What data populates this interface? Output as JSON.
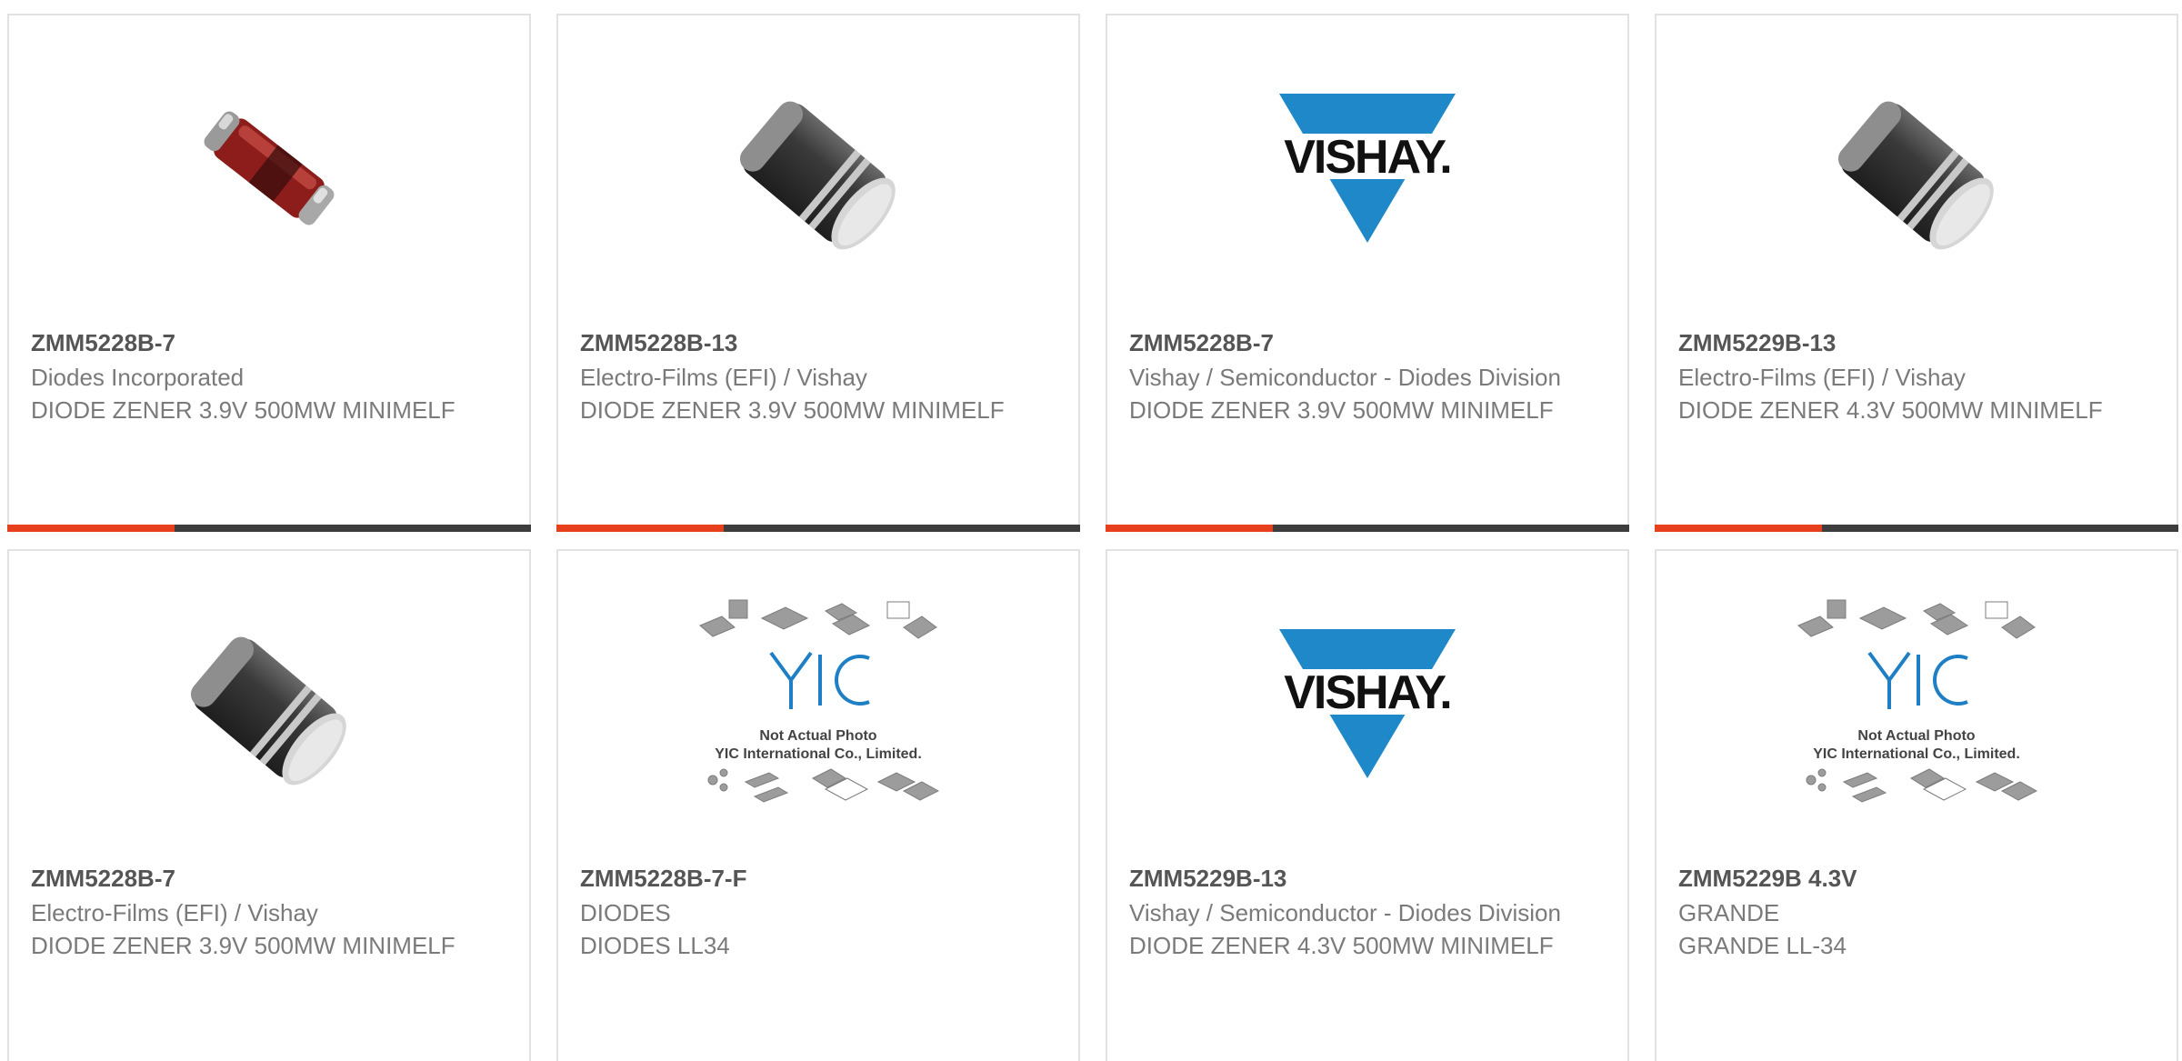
{
  "colors": {
    "accent": "#e8401c",
    "bar_dark": "#3d3d3d",
    "vishay_blue": "#1f88c9",
    "card_border": "#e2e2e2"
  },
  "products": [
    {
      "part_number": "ZMM5228B-7",
      "manufacturer": "Diodes Incorporated",
      "description": "DIODE ZENER 3.9V 500MW MINIMELF",
      "image": "red-melf-diode-photo"
    },
    {
      "part_number": "ZMM5228B-13",
      "manufacturer": "Electro-Films (EFI) / Vishay",
      "description": "DIODE ZENER 3.9V 500MW MINIMELF",
      "image": "black-melf-diode-photo"
    },
    {
      "part_number": "ZMM5228B-7",
      "manufacturer": "Vishay / Semiconductor - Diodes Division",
      "description": "DIODE ZENER 3.9V 500MW MINIMELF",
      "image": "vishay-logo",
      "logo_text": "VISHAY."
    },
    {
      "part_number": "ZMM5229B-13",
      "manufacturer": "Electro-Films (EFI) / Vishay",
      "description": "DIODE ZENER 4.3V 500MW MINIMELF",
      "image": "black-melf-diode-photo"
    },
    {
      "part_number": "ZMM5228B-7",
      "manufacturer": "Electro-Films (EFI) / Vishay",
      "description": "DIODE ZENER 3.9V 500MW MINIMELF",
      "image": "black-melf-diode-photo"
    },
    {
      "part_number": "ZMM5228B-7-F",
      "manufacturer": "DIODES",
      "description": "DIODES LL34",
      "image": "yic-placeholder",
      "placeholder_line1": "Not Actual Photo",
      "placeholder_line2": "YIC International Co., Limited."
    },
    {
      "part_number": "ZMM5229B-13",
      "manufacturer": "Vishay / Semiconductor - Diodes Division",
      "description": "DIODE ZENER 4.3V 500MW MINIMELF",
      "image": "vishay-logo",
      "logo_text": "VISHAY."
    },
    {
      "part_number": "ZMM5229B 4.3V",
      "manufacturer": "GRANDE",
      "description": "GRANDE LL-34",
      "image": "yic-placeholder",
      "placeholder_line1": "Not Actual Photo",
      "placeholder_line2": "YIC International Co., Limited."
    }
  ]
}
